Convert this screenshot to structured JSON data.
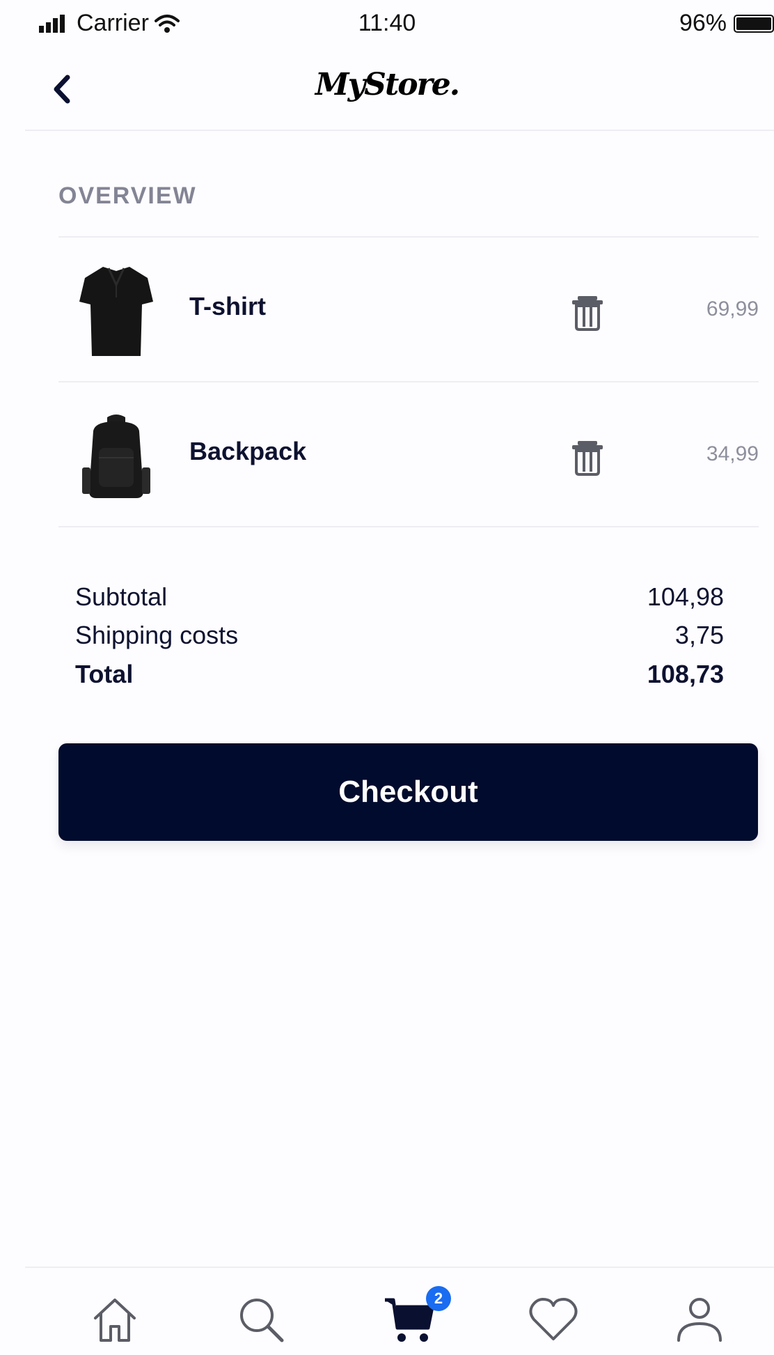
{
  "status_bar": {
    "carrier": "Carrier",
    "time": "11:40",
    "battery": "96%"
  },
  "header": {
    "logo": "MyStore.",
    "back_icon": "chevron-left-icon"
  },
  "overview": {
    "title": "OVERVIEW",
    "items": [
      {
        "name": "T-shirt",
        "price": "69,99",
        "image": "tshirt-image"
      },
      {
        "name": "Backpack",
        "price": "34,99",
        "image": "backpack-image"
      }
    ]
  },
  "totals": {
    "subtotal_label": "Subtotal",
    "subtotal_value": "104,98",
    "shipping_label": "Shipping costs",
    "shipping_value": "3,75",
    "total_label": "Total",
    "total_value": "108,73"
  },
  "checkout_label": "Checkout",
  "tab_bar": {
    "tabs": [
      "home-icon",
      "search-icon",
      "cart-icon",
      "heart-icon",
      "user-icon"
    ],
    "cart_badge": "2"
  },
  "colors": {
    "primary": "#000b2d",
    "badge": "#1a6cf0",
    "muted": "#838595"
  }
}
